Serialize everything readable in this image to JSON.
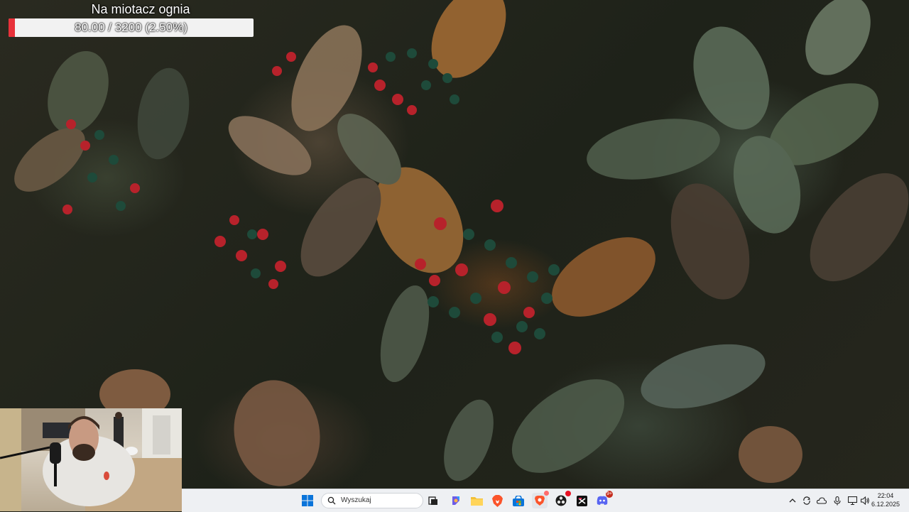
{
  "overlay": {
    "goal_title": "Na miotacz ognia",
    "goal_progress_text": "80.00 / 3200 (2.50%)",
    "goal_fraction": 0.025,
    "fill_color": "#e8313a"
  },
  "taskbar": {
    "search_placeholder": "Wyszukaj",
    "pinned_apps": [
      "windows-start-icon",
      "search-icon",
      "task-view-icon",
      "copilot-icon",
      "file-explorer-icon",
      "brave-browser-icon",
      "microsoft-store-icon",
      "vivaldi-browser-icon",
      "obs-studio-icon",
      "capcut-icon",
      "discord-icon"
    ],
    "badges": {
      "discord": "9+"
    },
    "clock": {
      "time": "22:04",
      "date": "6.12.2025"
    }
  },
  "tray": {
    "icons": [
      "chevron-up-icon",
      "sync-icon",
      "cloud-icon",
      "microphone-icon",
      "network-icon",
      "volume-icon"
    ]
  }
}
